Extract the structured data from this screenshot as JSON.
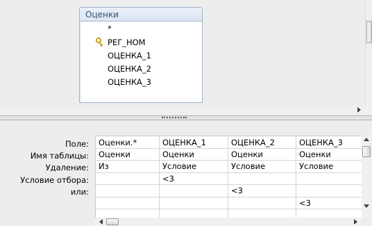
{
  "field_list": {
    "title": "Оценки",
    "items": [
      "*",
      "РЕГ_НОМ",
      "ОЦЕНКА_1",
      "ОЦЕНКА_2",
      "ОЦЕНКА_3"
    ]
  },
  "grid": {
    "row_labels": [
      "Поле:",
      "Имя таблицы:",
      "Удаление:",
      "Условие отбора:",
      "или:"
    ],
    "columns": [
      {
        "field": "Оценки.*",
        "table": "Оценки",
        "delete": "Из",
        "criteria": "",
        "or1": "",
        "or2": ""
      },
      {
        "field": "ОЦЕНКА_1",
        "table": "Оценки",
        "delete": "Условие",
        "criteria": "<3",
        "or1": "",
        "or2": ""
      },
      {
        "field": "ОЦЕНКА_2",
        "table": "Оценки",
        "delete": "Условие",
        "criteria": "",
        "or1": "<3",
        "or2": ""
      },
      {
        "field": "ОЦЕНКА_3",
        "table": "Оценки",
        "delete": "Условие",
        "criteria": "",
        "or1": "",
        "or2": "<3"
      }
    ]
  },
  "colors": {
    "accent": "#2f4f74",
    "panel_bg": "#ededed",
    "grid_line": "#d4d4d4"
  }
}
